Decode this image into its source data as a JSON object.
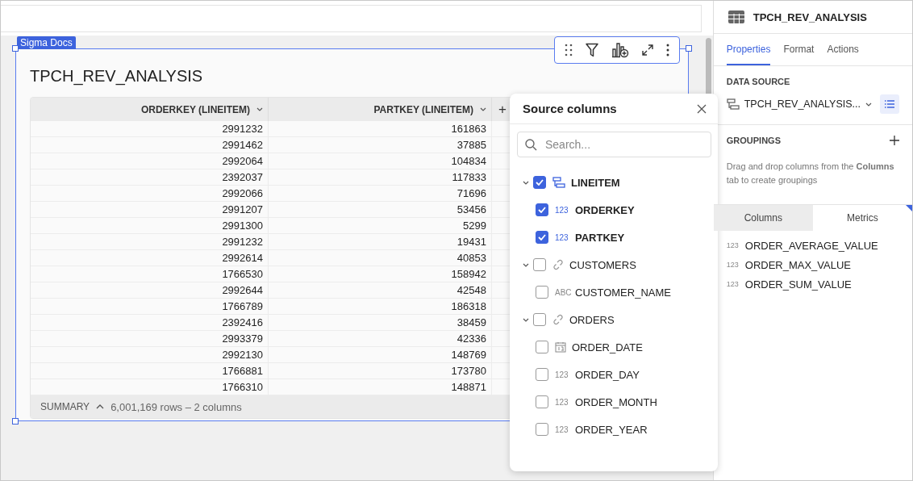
{
  "element": {
    "tag": "Sigma Docs",
    "title": "TPCH_REV_ANALYSIS"
  },
  "table": {
    "columns": [
      {
        "label": "ORDERKEY (LINEITEM)"
      },
      {
        "label": "PARTKEY (LINEITEM)"
      }
    ],
    "add_column": "+",
    "rows": [
      [
        "2991232",
        "161863"
      ],
      [
        "2991462",
        "37885"
      ],
      [
        "2992064",
        "104834"
      ],
      [
        "2392037",
        "117833"
      ],
      [
        "2992066",
        "71696"
      ],
      [
        "2991207",
        "53456"
      ],
      [
        "2991300",
        "5299"
      ],
      [
        "2991232",
        "19431"
      ],
      [
        "2992614",
        "40853"
      ],
      [
        "1766530",
        "158942"
      ],
      [
        "2992644",
        "42548"
      ],
      [
        "1766789",
        "186318"
      ],
      [
        "2392416",
        "38459"
      ],
      [
        "2993379",
        "42336"
      ],
      [
        "2992130",
        "148769"
      ],
      [
        "1766881",
        "173780"
      ],
      [
        "1766310",
        "148871"
      ]
    ],
    "summary": {
      "label": "SUMMARY",
      "text": "6,001,169 rows – 2 columns"
    }
  },
  "source_columns": {
    "title": "Source columns",
    "search": {
      "placeholder": "Search..."
    },
    "items": [
      {
        "label": "LINEITEM",
        "kind": "table",
        "checked": true,
        "expanded": true,
        "children": [
          {
            "label": "ORDERKEY",
            "kind": "number",
            "type_label": "123",
            "checked": true
          },
          {
            "label": "PARTKEY",
            "kind": "number",
            "type_label": "123",
            "checked": true
          }
        ]
      },
      {
        "label": "CUSTOMERS",
        "kind": "link",
        "checked": false,
        "expanded": true,
        "children": [
          {
            "label": "CUSTOMER_NAME",
            "kind": "text",
            "type_label": "ABC",
            "checked": false
          }
        ]
      },
      {
        "label": "ORDERS",
        "kind": "link",
        "checked": false,
        "expanded": true,
        "children": [
          {
            "label": "ORDER_DATE",
            "kind": "date",
            "checked": false
          },
          {
            "label": "ORDER_DAY",
            "kind": "number",
            "type_label": "123",
            "checked": false
          },
          {
            "label": "ORDER_MONTH",
            "kind": "number",
            "type_label": "123",
            "checked": false
          },
          {
            "label": "ORDER_YEAR",
            "kind": "number",
            "type_label": "123",
            "checked": false
          }
        ]
      }
    ]
  },
  "panel": {
    "title": "TPCH_REV_ANALYSIS",
    "tabs": [
      {
        "label": "Properties",
        "selected": true
      },
      {
        "label": "Format",
        "selected": false
      },
      {
        "label": "Actions",
        "selected": false
      }
    ],
    "data_source": {
      "heading": "DATA SOURCE",
      "value": "TPCH_REV_ANALYSIS..."
    },
    "groupings": {
      "heading": "GROUPINGS",
      "hint": "Drag and drop columns from the **Columns** tab to create groupings"
    },
    "list_tabs": [
      {
        "label": "Columns",
        "selected": false
      },
      {
        "label": "Metrics",
        "selected": true
      }
    ],
    "metrics": [
      {
        "type_label": "123",
        "label": "ORDER_AVERAGE_VALUE"
      },
      {
        "type_label": "123",
        "label": "ORDER_MAX_VALUE"
      },
      {
        "type_label": "123",
        "label": "ORDER_SUM_VALUE"
      }
    ]
  }
}
